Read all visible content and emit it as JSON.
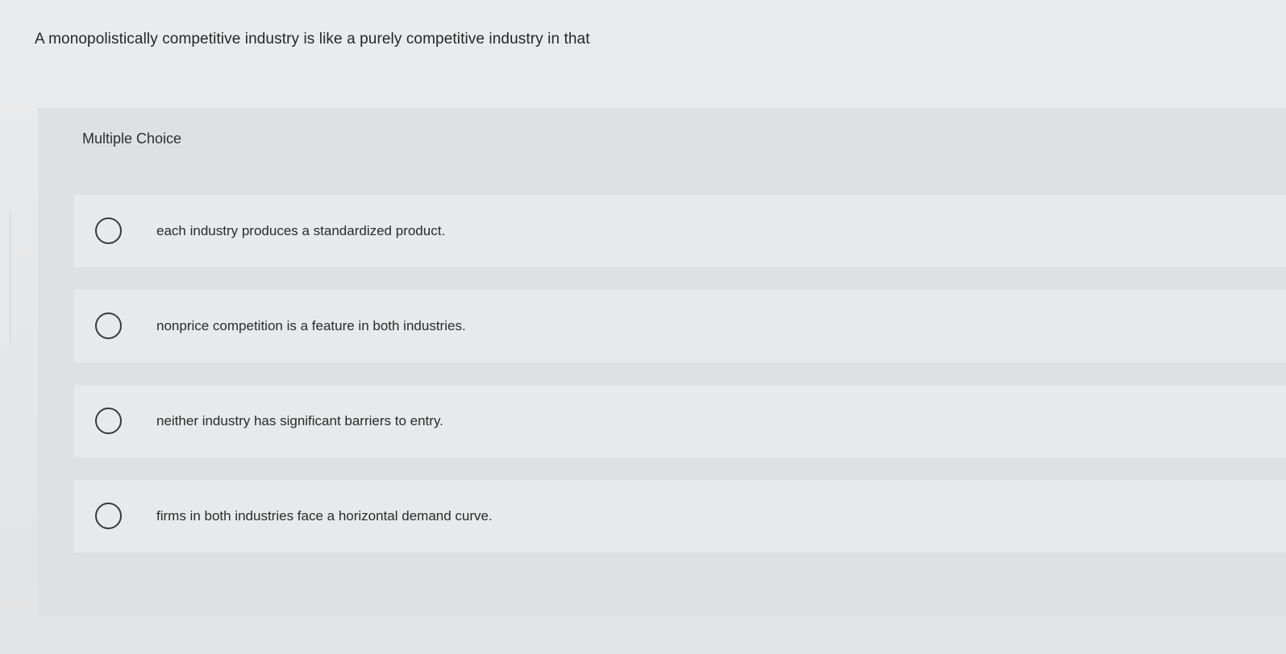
{
  "question": {
    "text": "A monopolistically competitive industry is like a purely competitive industry in that"
  },
  "panel": {
    "label": "Multiple Choice"
  },
  "options": [
    {
      "text": "each industry produces a standardized product."
    },
    {
      "text": "nonprice competition is a feature in both industries."
    },
    {
      "text": "neither industry has significant barriers to entry."
    },
    {
      "text": "firms in both industries face a horizontal demand curve."
    }
  ]
}
